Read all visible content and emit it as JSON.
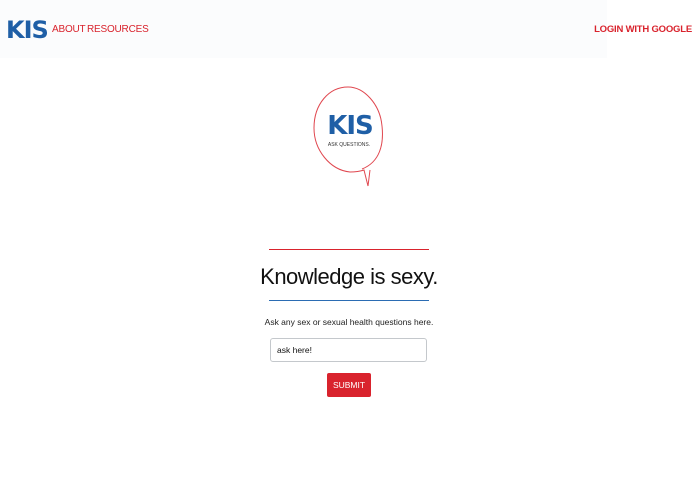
{
  "colors": {
    "brand_blue": "#1f5fa6",
    "accent_red": "#d9232d",
    "rule_blue": "#2b6cb3",
    "navbar_bg": "#fbfcfd"
  },
  "navbar": {
    "brand": "KIS",
    "links": [
      {
        "label": "ABOUT"
      },
      {
        "label": "RESOURCES"
      }
    ],
    "login_label": "LOGIN WITH GOOGLE"
  },
  "logo": {
    "text": "KIS",
    "tagline": "ASK QUESTIONS."
  },
  "hero": {
    "headline": "Knowledge is sexy.",
    "subtitle": "Ask any sex or sexual health questions here."
  },
  "form": {
    "input_value": "",
    "input_placeholder": "ask here!",
    "submit_label": "SUBMIT"
  }
}
